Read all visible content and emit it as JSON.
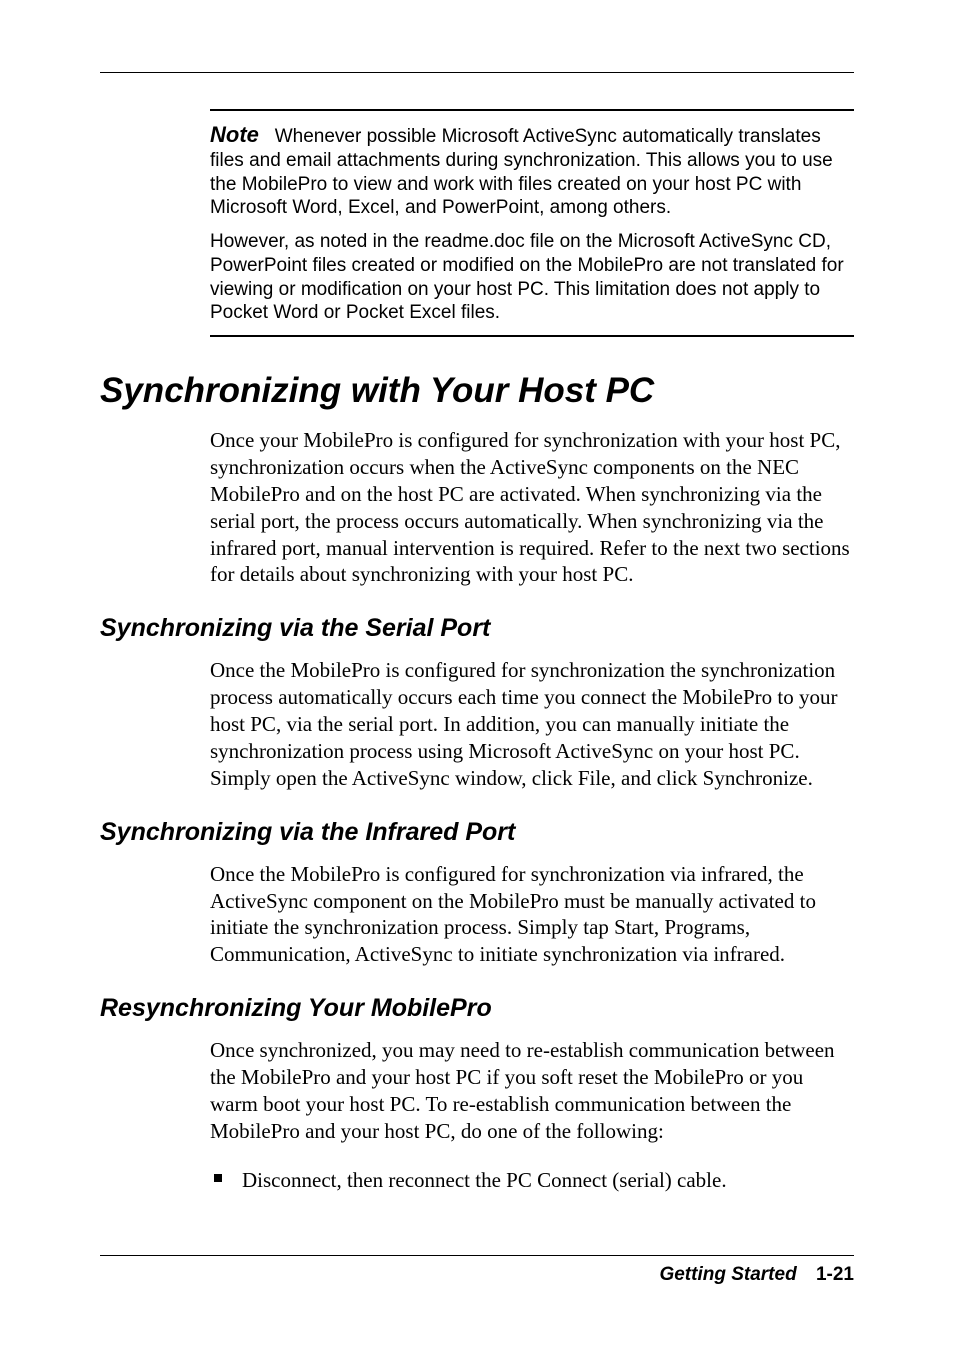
{
  "note": {
    "label": "Note",
    "para1": "Whenever possible Microsoft ActiveSync automatically translates files and email attachments during synchronization. This allows you to use the MobilePro to view and work with files created on your host PC with Microsoft Word, Excel, and PowerPoint, among others.",
    "para2": "However, as noted in the readme.doc file on the Microsoft ActiveSync CD, PowerPoint files created or modified on the MobilePro are not translated for viewing or modification on your host PC. This limitation does not apply to Pocket Word or Pocket Excel files."
  },
  "section": {
    "title": "Synchronizing with Your Host PC",
    "intro": "Once your MobilePro is configured for synchronization with your host PC, synchronization occurs when the ActiveSync components on the NEC MobilePro and on the host PC are activated. When synchronizing via the serial port, the process occurs automatically. When synchronizing via the infrared port, manual intervention is required. Refer to the next two sections for details about synchronizing with your host PC."
  },
  "sub1": {
    "heading": "Synchronizing via the Serial Port",
    "body": "Once the MobilePro is configured for synchronization the synchronization process automatically occurs each time you connect the MobilePro to your host PC, via the serial port. In addition, you can manually initiate the synchronization process using Microsoft ActiveSync on your host PC. Simply open the ActiveSync window, click File, and click Synchronize."
  },
  "sub2": {
    "heading": "Synchronizing via the Infrared Port",
    "body": "Once the MobilePro is configured for synchronization via infrared, the ActiveSync component on the MobilePro must be manually activated to initiate the synchronization process. Simply tap Start, Programs, Communication, ActiveSync to initiate synchronization via infrared."
  },
  "sub3": {
    "heading": "Resynchronizing Your MobilePro",
    "body": "Once synchronized, you may need to re-establish communication between the MobilePro and your host PC if you soft reset the MobilePro or you warm boot your host PC. To re-establish communication between the MobilePro and your host PC, do one of the following:",
    "bullets": [
      "Disconnect, then reconnect the PC Connect (serial) cable."
    ]
  },
  "footer": {
    "label": "Getting Started",
    "pagenum": "1-21"
  }
}
